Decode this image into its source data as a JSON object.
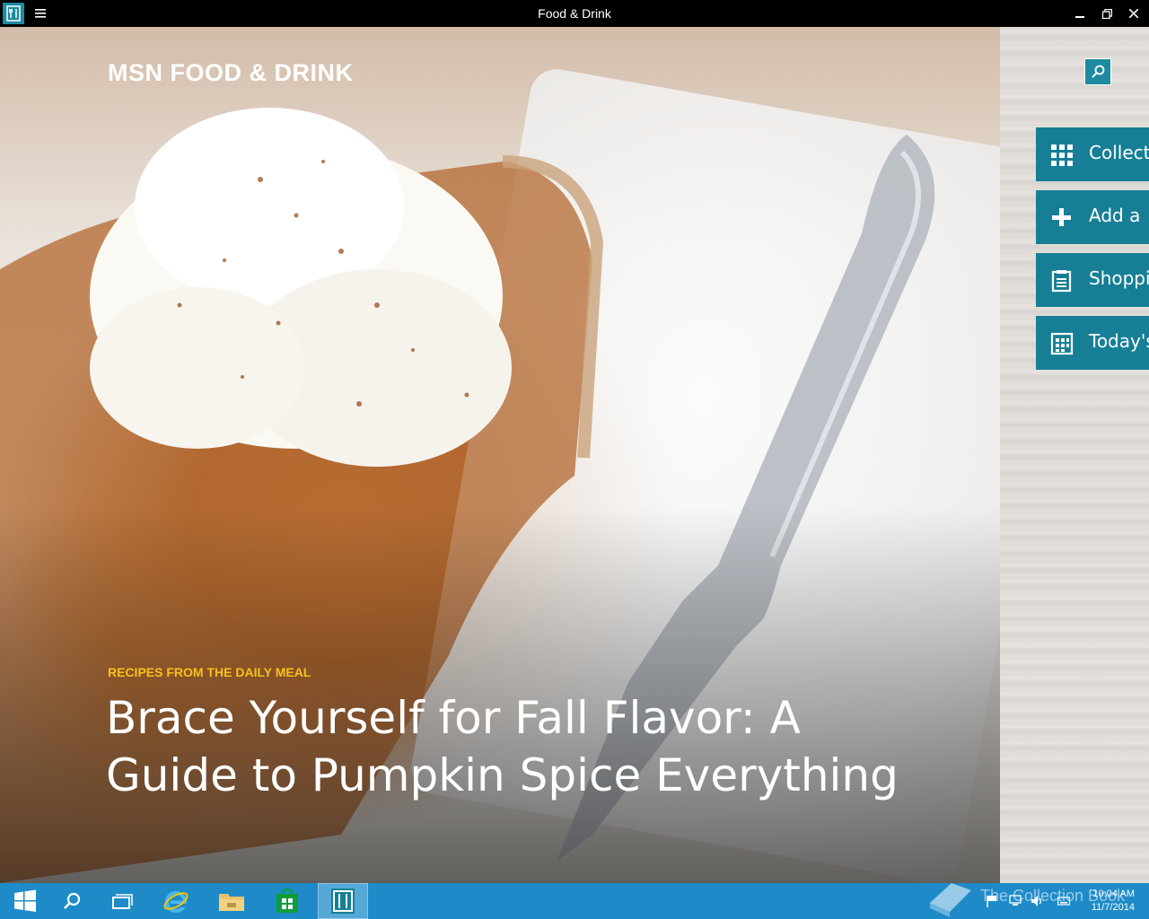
{
  "window": {
    "title": "Food & Drink",
    "app_icon": "fork-knife-icon",
    "menu_icon": "hamburger-menu-icon",
    "controls": [
      "minimize-icon",
      "restore-icon",
      "close-icon"
    ]
  },
  "hero": {
    "brand": "MSN FOOD & DRINK",
    "kicker": "RECIPES FROM THE DAILY MEAL",
    "headline": "Brace Yourself for Fall Flavor: A Guide to Pumpkin Spice Everything",
    "image_subject": "pumpkin pie slice with whipped cream and fork"
  },
  "side_panel": {
    "search_icon": "search-icon",
    "items": [
      {
        "label": "Collect",
        "icon": "grid-icon"
      },
      {
        "label": "Add a",
        "icon": "plus-icon"
      },
      {
        "label": "Shoppi",
        "icon": "list-icon"
      },
      {
        "label": "Today's",
        "icon": "calendar-icon"
      }
    ]
  },
  "taskbar": {
    "items": [
      {
        "name": "start",
        "icon": "windows-logo-icon"
      },
      {
        "name": "search",
        "icon": "search-icon"
      },
      {
        "name": "task-view",
        "icon": "task-view-icon"
      },
      {
        "name": "internet-explorer",
        "icon": "ie-icon"
      },
      {
        "name": "file-explorer",
        "icon": "folder-icon"
      },
      {
        "name": "store",
        "icon": "store-icon"
      },
      {
        "name": "food-drink",
        "icon": "fork-knife-icon",
        "active": true
      }
    ],
    "watermark": "The Collection Book",
    "time": "10:04 AM",
    "date": "11/7/2014"
  },
  "colors": {
    "accent": "#167f95",
    "taskbar": "#1e8bc8",
    "kicker": "#f6c21a"
  }
}
